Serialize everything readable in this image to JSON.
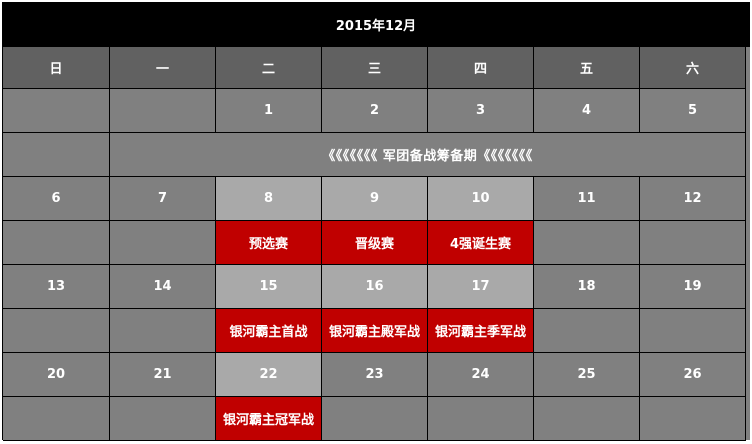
{
  "title": "2015年12月",
  "weekdays": [
    "日",
    "一",
    "二",
    "三",
    "四",
    "五",
    "六"
  ],
  "weeks": [
    {
      "days": [
        "",
        "",
        "1",
        "2",
        "3",
        "4",
        "5"
      ],
      "highlight": [
        false,
        false,
        false,
        false,
        false,
        false,
        false
      ],
      "banner": "《《《《《《《 军团备战筹备期《《《《《《《",
      "events": [
        "",
        "",
        "",
        "",
        "",
        "",
        ""
      ]
    },
    {
      "days": [
        "6",
        "7",
        "8",
        "9",
        "10",
        "11",
        "12"
      ],
      "highlight": [
        false,
        false,
        true,
        true,
        true,
        false,
        false
      ],
      "events": [
        "",
        "",
        "预选赛",
        "晋级赛",
        "4强诞生赛",
        "",
        ""
      ]
    },
    {
      "days": [
        "13",
        "14",
        "15",
        "16",
        "17",
        "18",
        "19"
      ],
      "highlight": [
        false,
        false,
        true,
        true,
        true,
        false,
        false
      ],
      "events": [
        "",
        "",
        "银河霸主首战",
        "银河霸主殿军战",
        "银河霸主季军战",
        "",
        ""
      ]
    },
    {
      "days": [
        "20",
        "21",
        "22",
        "23",
        "24",
        "25",
        "26"
      ],
      "highlight": [
        false,
        false,
        true,
        false,
        false,
        false,
        false
      ],
      "events": [
        "",
        "",
        "银河霸主冠军战",
        "",
        "",
        "",
        ""
      ]
    }
  ],
  "colors": {
    "title_bg": "#000000",
    "header_bg": "#616161",
    "cell_bg": "#808080",
    "highlight_bg": "#a9a9a9",
    "event_bg": "#c00000",
    "text": "#ffffff"
  }
}
